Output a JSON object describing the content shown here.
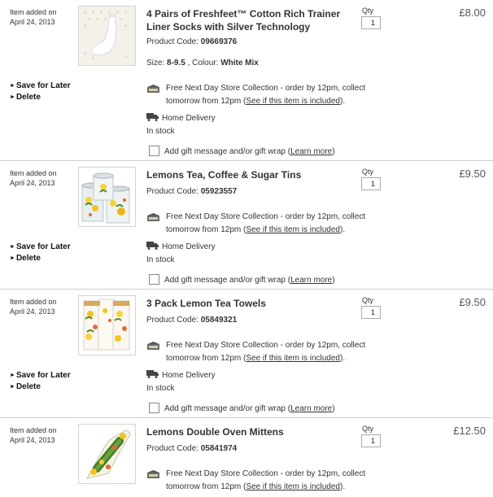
{
  "items": [
    {
      "added_label": "Item added on",
      "added_date": "April 24, 2013",
      "title": "4 Pairs of Freshfeet™ Cotton Rich Trainer Liner Socks with Silver Technology",
      "code_label": "Product Code:",
      "code": "09669376",
      "size_label": "Size:",
      "size": "8-9.5",
      "colour_label": "Colour:",
      "colour": "White Mix",
      "qty_label": "Qty",
      "qty": "1",
      "price": "£8.00",
      "save_label": "Save for Later",
      "delete_label": "Delete",
      "store_text": "Free Next Day Store Collection - order by 12pm, collect",
      "store_text2": "tomorrow from 12pm",
      "store_link": "See if this item is included",
      "home_delivery": "Home Delivery",
      "stock": "In stock",
      "gift_text": "Add gift message and/or gift wrap",
      "gift_link": "Learn more",
      "thumb": "socks-image"
    },
    {
      "added_label": "Item added on",
      "added_date": "April 24, 2013",
      "title": "Lemons Tea, Coffee & Sugar Tins",
      "code_label": "Product Code:",
      "code": "05923557",
      "qty_label": "Qty",
      "qty": "1",
      "price": "£9.50",
      "save_label": "Save for Later",
      "delete_label": "Delete",
      "store_text": "Free Next Day Store Collection - order by 12pm, collect",
      "store_text2": "tomorrow from 12pm",
      "store_link": "See if this item is included",
      "home_delivery": "Home Delivery",
      "stock": "In stock",
      "gift_text": "Add gift message and/or gift wrap",
      "gift_link": "Learn more",
      "thumb": "tins-image"
    },
    {
      "added_label": "Item added on",
      "added_date": "April 24, 2013",
      "title": "3 Pack Lemon Tea Towels",
      "code_label": "Product Code:",
      "code": "05849321",
      "qty_label": "Qty",
      "qty": "1",
      "price": "£9.50",
      "save_label": "Save for Later",
      "delete_label": "Delete",
      "store_text": "Free Next Day Store Collection - order by 12pm, collect",
      "store_text2": "tomorrow from 12pm",
      "store_link": "See if this item is included",
      "home_delivery": "Home Delivery",
      "stock": "In stock",
      "gift_text": "Add gift message and/or gift wrap",
      "gift_link": "Learn more",
      "thumb": "tea-towels-image"
    },
    {
      "added_label": "Item added on",
      "added_date": "April 24, 2013",
      "title": "Lemons Double Oven Mittens",
      "code_label": "Product Code:",
      "code": "05841974",
      "qty_label": "Qty",
      "qty": "1",
      "price": "£12.50",
      "store_text": "Free Next Day Store Collection - order by 12pm, collect",
      "store_text2": "tomorrow from 12pm",
      "store_link": "See if this item is included",
      "thumb": "oven-mittens-image"
    }
  ],
  "colors": {
    "border": "#cfcfcf",
    "text": "#333333",
    "price": "#555555"
  },
  "icons": {
    "store": "store-collection-icon",
    "home": "delivery-truck-icon",
    "bullet": "arrow-bullet-icon"
  }
}
